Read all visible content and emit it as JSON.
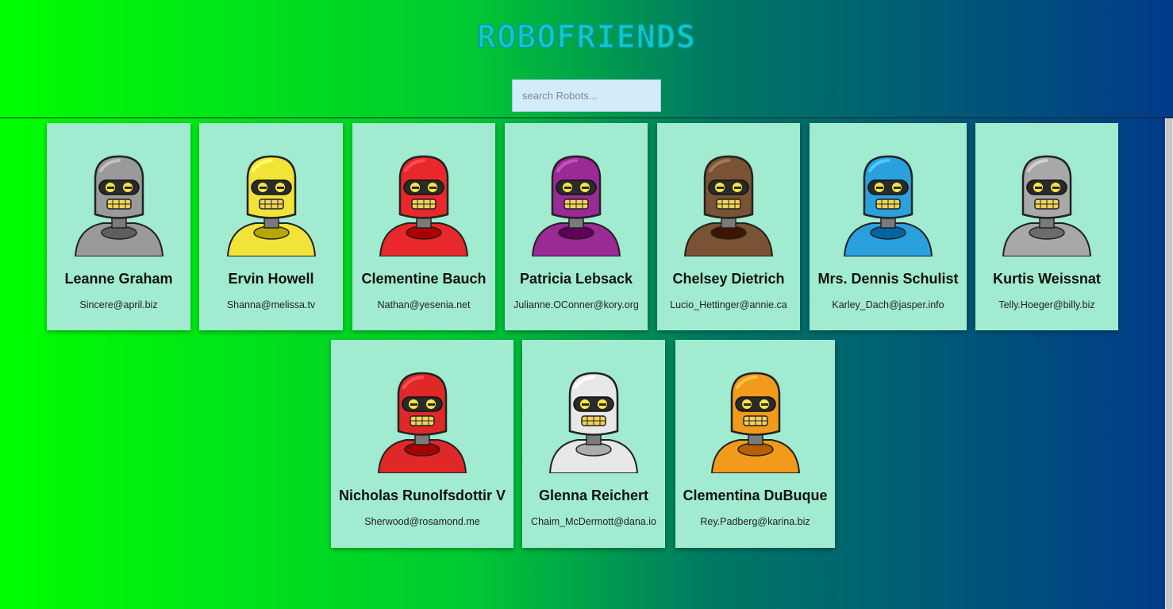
{
  "header": {
    "title": "ROBOFRIENDS"
  },
  "search": {
    "placeholder": "search Robots...",
    "value": ""
  },
  "robots": [
    {
      "name": "Leanne Graham",
      "email": "Sincere@april.biz",
      "color": "#9a9a9a"
    },
    {
      "name": "Ervin Howell",
      "email": "Shanna@melissa.tv",
      "color": "#f2e338"
    },
    {
      "name": "Clementine Bauch",
      "email": "Nathan@yesenia.net",
      "color": "#e8282a"
    },
    {
      "name": "Patricia Lebsack",
      "email": "Julianne.OConner@kory.org",
      "color": "#9a2a96"
    },
    {
      "name": "Chelsey Dietrich",
      "email": "Lucio_Hettinger@annie.ca",
      "color": "#7a5234"
    },
    {
      "name": "Mrs. Dennis Schulist",
      "email": "Karley_Dach@jasper.info",
      "color": "#2aa0dc"
    },
    {
      "name": "Kurtis Weissnat",
      "email": "Telly.Hoeger@billy.biz",
      "color": "#a8a8a8"
    },
    {
      "name": "Nicholas Runolfsdottir V",
      "email": "Sherwood@rosamond.me",
      "color": "#e02828"
    },
    {
      "name": "Glenna Reichert",
      "email": "Chaim_McDermott@dana.io",
      "color": "#e8e8e8"
    },
    {
      "name": "Clementina DuBuque",
      "email": "Rey.Padberg@karina.biz",
      "color": "#f29a1c"
    }
  ]
}
